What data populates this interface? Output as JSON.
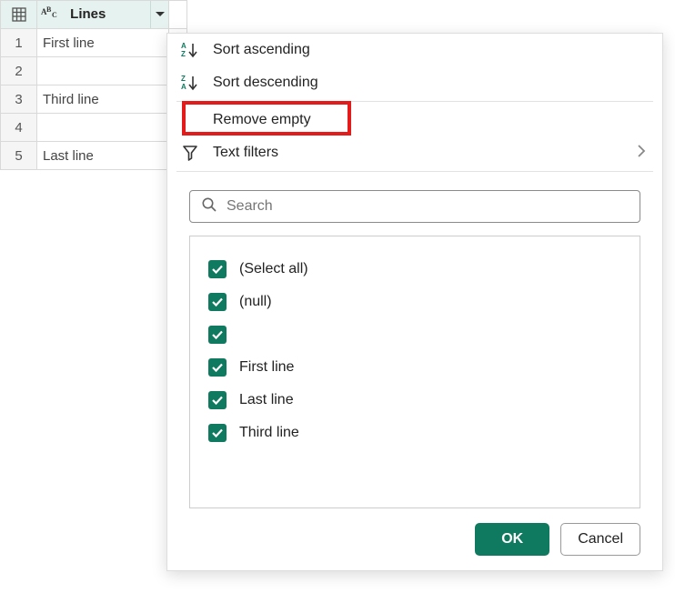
{
  "column": {
    "name": "Lines",
    "type_icon": "text-abc"
  },
  "rows": [
    {
      "num": "1",
      "value": "First line"
    },
    {
      "num": "2",
      "value": ""
    },
    {
      "num": "3",
      "value": "Third line"
    },
    {
      "num": "4",
      "value": ""
    },
    {
      "num": "5",
      "value": "Last line"
    }
  ],
  "menu": {
    "sort_asc": "Sort ascending",
    "sort_desc": "Sort descending",
    "remove_empty": "Remove empty",
    "text_filters": "Text filters"
  },
  "search": {
    "placeholder": "Search"
  },
  "filter_values": [
    {
      "label": "(Select all)",
      "checked": true
    },
    {
      "label": "(null)",
      "checked": true
    },
    {
      "label": "",
      "checked": true
    },
    {
      "label": "First line",
      "checked": true
    },
    {
      "label": "Last line",
      "checked": true
    },
    {
      "label": "Third line",
      "checked": true
    }
  ],
  "buttons": {
    "ok": "OK",
    "cancel": "Cancel"
  },
  "highlighted_item": "remove_empty",
  "colors": {
    "accent": "#0f7a5f",
    "highlight_border": "#e31b1b"
  }
}
